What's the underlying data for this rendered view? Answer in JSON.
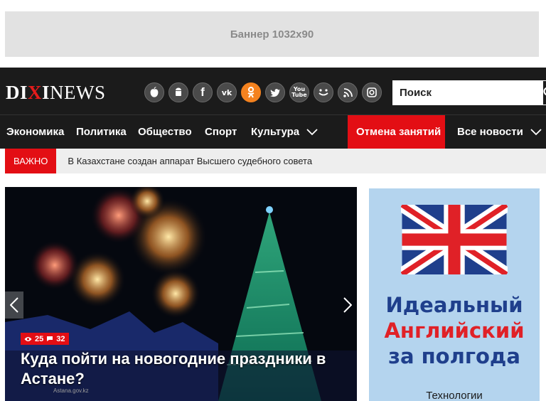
{
  "banner": {
    "text": "Баннер 1032x90"
  },
  "header": {
    "logo_dixi_left": "DI",
    "logo_dixi_x": "X",
    "logo_dixi_right": "I",
    "logo_news": "NEWS",
    "socials": [
      {
        "name": "apple-icon",
        "glyph": ""
      },
      {
        "name": "android-icon",
        "glyph": "◉"
      },
      {
        "name": "facebook-icon",
        "glyph": "f"
      },
      {
        "name": "vk-icon",
        "glyph": "vk"
      },
      {
        "name": "odnoklassniki-icon",
        "glyph": "ок"
      },
      {
        "name": "twitter-icon",
        "glyph": "t"
      },
      {
        "name": "youtube-icon",
        "glyph": "▶"
      },
      {
        "name": "moimir-icon",
        "glyph": "☺"
      },
      {
        "name": "rss-icon",
        "glyph": "≋"
      },
      {
        "name": "instagram-icon",
        "glyph": "◎"
      }
    ],
    "search_placeholder": "Поиск"
  },
  "nav": {
    "items": [
      "Экономика",
      "Политика",
      "Общество",
      "Спорт",
      "Культура"
    ],
    "highlight": "Отмена занятий",
    "all_news": "Все новости"
  },
  "breaking": {
    "badge": "ВАЖНО",
    "text": "В Казахстане создан аппарат Высшего судебного совета"
  },
  "slide": {
    "views": "25",
    "comments": "32",
    "headline": "Куда пойти на новогодние праздники в Астане?",
    "credit": "Astana.gov.kz"
  },
  "ad": {
    "line1": "Идеальный",
    "line2": "Английский",
    "line3": "за полгода",
    "sub": "Технологии"
  },
  "colors": {
    "accent": "#e30e14",
    "dark": "#1b1b1b",
    "ad_blue": "#1f3f8c"
  }
}
